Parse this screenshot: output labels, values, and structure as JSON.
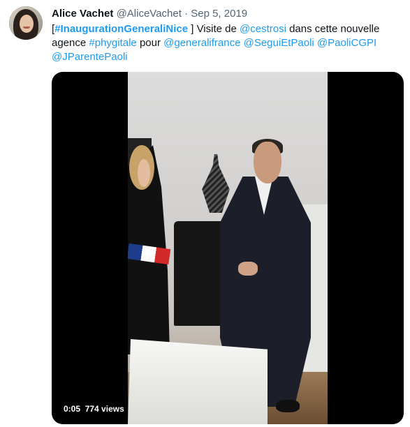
{
  "tweet": {
    "author_name": "Alice Vachet",
    "author_handle": "@AliceVachet",
    "separator": "·",
    "date": "Sep 5, 2019",
    "text": {
      "open_bracket": "[",
      "hashtag_main": "#InaugurationGeneraliNice",
      "part1": " ] Visite de ",
      "mention_1": "@cestrosi",
      "part2": " dans cette nouvelle agence ",
      "hashtag_2": "#phygitale",
      "part3": " pour ",
      "mention_2": "@generalifrance",
      "mention_3": "@SeguiEtPaoli",
      "mention_4": "@PaoliCGPI",
      "mention_5": "@JParentePaoli"
    }
  },
  "video": {
    "time": "0:05",
    "views": "774 views"
  },
  "colors": {
    "link": "#1d9bf0",
    "secondary_text": "#536471",
    "primary_text": "#0f1419"
  }
}
